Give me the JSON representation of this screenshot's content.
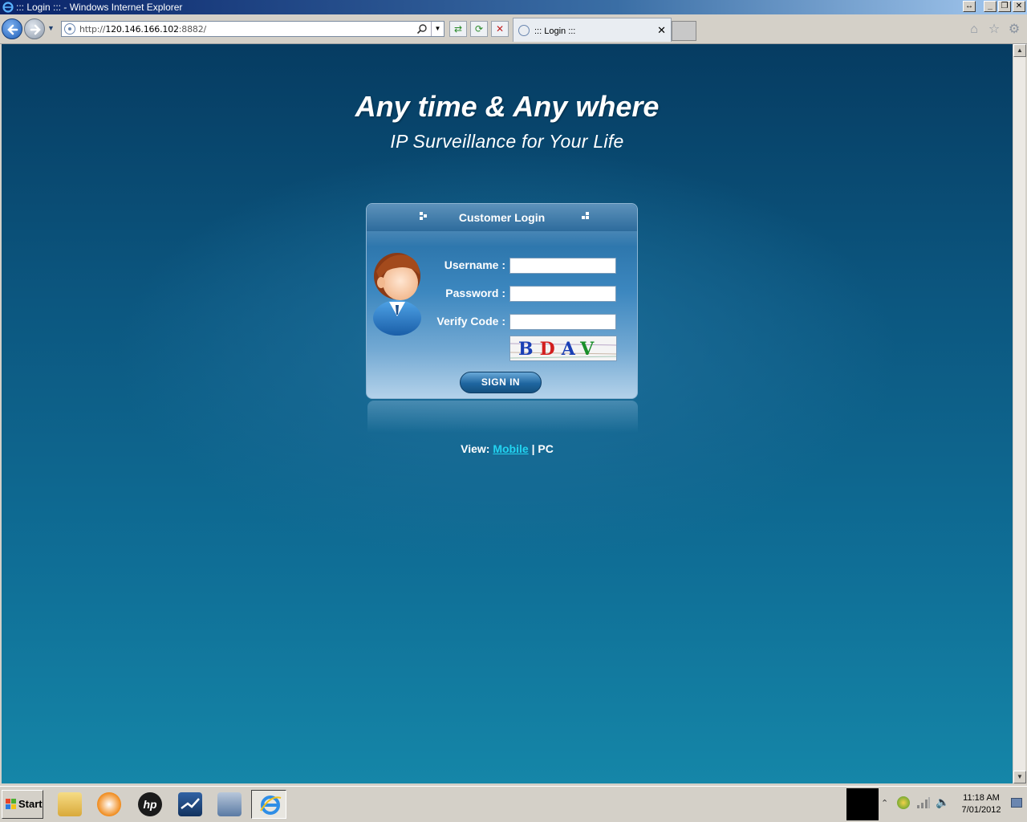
{
  "window": {
    "title": "::: Login ::: - Windows Internet Explorer",
    "controls": [
      "↔",
      "_",
      "❐",
      "✕"
    ]
  },
  "toolbar": {
    "url_scheme": "http://",
    "url_host": "120.146.166.102",
    "url_port_path": ":8882/",
    "tab_label": "::: Login :::",
    "tab_close": "✕"
  },
  "page": {
    "headline": "Any time & Any where",
    "subline": "IP Surveillance for Your Life",
    "login": {
      "title": "Customer Login",
      "username_label": "Username :",
      "password_label": "Password :",
      "verify_label": "Verify Code :",
      "username_value": "",
      "password_value": "",
      "verify_value": "",
      "captcha": [
        {
          "char": "B",
          "color": "#1a3fb5"
        },
        {
          "char": "D",
          "color": "#d21f1f"
        },
        {
          "char": "A",
          "color": "#1a3fb5"
        },
        {
          "char": "V",
          "color": "#1a8f2a"
        }
      ],
      "signin_label": "SIGN IN"
    },
    "view": {
      "prefix": "View:",
      "mobile": "Mobile",
      "separator": "|",
      "pc": "PC"
    }
  },
  "taskbar": {
    "start_label": "Start",
    "clock_time": "11:18 AM",
    "clock_date": "7/01/2012"
  }
}
